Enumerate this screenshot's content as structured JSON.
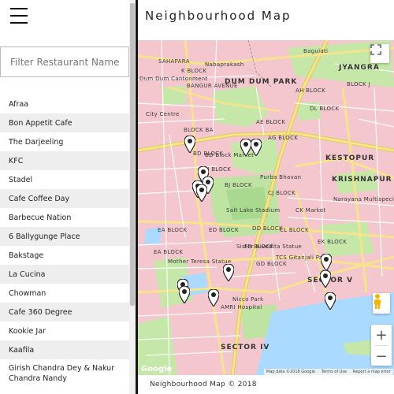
{
  "header": {
    "title": "Neighbourhood Map"
  },
  "sidebar": {
    "filter_placeholder": "Filter Restaurant Names",
    "items": [
      "Afraa",
      "Bon Appetit Cafe",
      "The Darjeeling",
      "KFC",
      "Stadel",
      "Cafe Coffee Day",
      "Barbecue Nation",
      "6 Ballygunge Place",
      "Bakstage",
      "La Cucina",
      "Chowman",
      "Cafe 360 Degree",
      "Kookie Jar",
      "Kaafila",
      "Girish Chandra Dey & Nakur Chandra Nandy"
    ]
  },
  "map": {
    "labels": {
      "sahapara": "SAHAPARA",
      "bangur_avenue": "BANGUR AVENUE",
      "dum_dum_park": "DUM DUM PARK",
      "jyangra": "JYANGRA",
      "block_j": "BLOCK J",
      "kestopur": "KESTOPUR",
      "krishnapur": "KRISHNAPUR",
      "sector_v": "SECTOR V",
      "sector_iv": "SECTOR IV",
      "ae_block": "AE BLOCK",
      "ag_block": "AG BLOCK",
      "bj_block": "BJ BLOCK",
      "cj_block": "CJ BLOCK",
      "ea_block": "EA BLOCK",
      "ed_block": "ED BLOCK",
      "cl_block": "CL BLOCK",
      "fd_block": "FD BLOCK",
      "block_ba": "BLOCK BA",
      "bd_block": "BD BLOCK",
      "bh_block": "BH BLOCK",
      "gd_block": "GD BLOCK",
      "dl_block": "DL BLOCK",
      "ek_block": "EK BLOCK",
      "ea_block2": "EA BLOCK",
      "dd_block": "DD BLOCK",
      "mother_teresa": "Mother Teresa Statue",
      "sister_nivedita": "Sister Nivedita Statue",
      "ck_market": "CK Market",
      "purba_bhavan": "Purba Bhavan",
      "salt_lake_stadium": "Salt Lake Stadium",
      "bd_block_market": "BD Block Market",
      "tcs": "TCS Gitanjali Park",
      "city_centre": "City Centre",
      "amri": "AMRI Hospital",
      "nicco_park": "Nicco Park",
      "narayana": "Narayana Multispeciality",
      "nabaprakash": "Nabaprakash",
      "baguiati": "Baguiati",
      "dum_dum_cantt": "Dum Dum Cantonment",
      "k_block": "K BLOCK",
      "ah_block": "AH BLOCK"
    },
    "zoom_in": "+",
    "zoom_out": "−",
    "attribution": [
      "Map data ©2018 Google",
      "Terms of Use",
      "Report a map error"
    ],
    "google_logo": "Google",
    "markers": 16
  },
  "footer": {
    "text": "Neighbourhood Map © 2018"
  },
  "colors": {
    "map_bg": "#f4c7cf",
    "park": "#c5e8a8",
    "park_dark": "#8fd17a",
    "water": "#aadaff",
    "road_major": "#f7e48a",
    "road_minor": "#ffffff",
    "highway": "#dccb5a"
  }
}
